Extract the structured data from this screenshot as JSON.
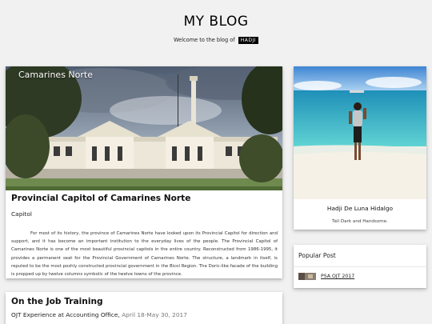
{
  "header": {
    "title": "MY BLOG",
    "welcome_text": "Welcome to the blog of",
    "owner_badge": "HADJI"
  },
  "posts": [
    {
      "image_caption": "Camarines Norte",
      "title": "Provincial Capitol of Camarines Norte",
      "subtitle": "Capitol",
      "body": "For most of its history, the province of Camarines Norte have looked upon its Provincial Capitol for direction and support, and it has become an important institution to the everyday lives of the people. The Provincial Capitol of Camarines Norte is one of the most beautiful provincial capitols in the entire country. Reconstructed from 1986-1995, it provides a permanent seat for the Provincial Government of Camarines Norte. The structure, a landmark in itself, is reputed to be the most poshly constructed provincial government in the Bicol Region. The Doric-like facade of the building is propped up by twelve columns symbolic of the twelve towns of the province."
    },
    {
      "title": "On the Job Training",
      "subtitle": "OJT Experience at Accounting Office,",
      "date": "April 18-May 30, 2017"
    }
  ],
  "profile": {
    "name": "Hadji De Luna Hidalgo",
    "tagline": "Tall Dark and Handsome."
  },
  "popular": {
    "header": "Popular Post",
    "items": [
      {
        "label": "PSA OJT 2017",
        "thumb_icon": "post-thumbnail-image"
      }
    ]
  }
}
